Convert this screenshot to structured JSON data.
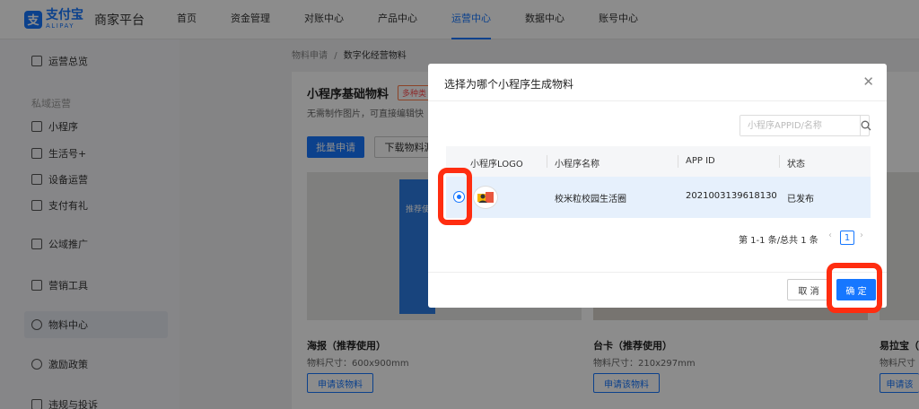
{
  "brand": {
    "logo_cn": "支付宝",
    "logo_en": "ALIPAY",
    "platform": "商家平台",
    "accent": "#1677ff"
  },
  "nav": {
    "items": [
      "首页",
      "资金管理",
      "对账中心",
      "产品中心",
      "运营中心",
      "数据中心",
      "账号中心"
    ],
    "active_index": 4
  },
  "sidebar": {
    "overview": "运营总览",
    "group_private": "私域运营",
    "miniapp": "小程序",
    "lifeno": "生活号+",
    "device": "设备运营",
    "payment_gift": "支付有礼",
    "public_promo": "公域推广",
    "marketing": "营销工具",
    "material": "物料中心",
    "incentive": "激励政策",
    "violation": "违规与投诉"
  },
  "breadcrumb": {
    "parent": "物料申请",
    "sep": "/",
    "current": "数字化经营物料"
  },
  "card": {
    "title": "小程序基础物料",
    "tag": "多种类",
    "desc": "无需制作图片，可直接编辑快",
    "batch_btn": "批量申请",
    "download_btn": "下载物料源",
    "poster_text": "推荐使",
    "items": [
      {
        "name": "海报（推荐使用）",
        "size": "物料尺寸：600x900mm",
        "btn": "申请该物料"
      },
      {
        "name": "台卡（推荐使用）",
        "size": "物料尺寸：210x297mm",
        "btn": "申请该物料"
      },
      {
        "name": "易拉宝（",
        "size": "物料尺寸",
        "btn": "申请该"
      }
    ]
  },
  "modal": {
    "title": "选择为哪个小程序生成物料",
    "search_placeholder": "小程序APPID/名称",
    "columns": [
      "小程序LOGO",
      "小程序名称",
      "APP ID",
      "状态"
    ],
    "rows": [
      {
        "name": "校米粒校园生活圈",
        "app_id": "2021003139618130",
        "status": "已发布",
        "selected": true
      }
    ],
    "pager_text": "第 1-1 条/总共 1 条",
    "page_prev": "‹",
    "page_current": "1",
    "page_next": "›",
    "cancel": "取 消",
    "confirm": "确 定"
  },
  "highlight_color": "#ff2d10"
}
